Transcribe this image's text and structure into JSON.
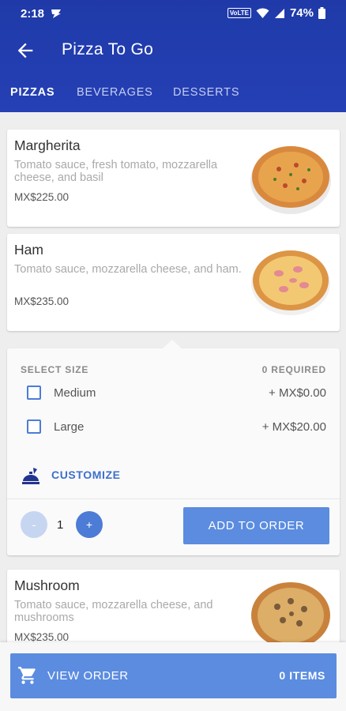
{
  "status_bar": {
    "time": "2:18",
    "network": "VoLTE",
    "battery": "74%"
  },
  "header": {
    "title": "Pizza To Go"
  },
  "tabs": [
    {
      "label": "PIZZAS",
      "active": true
    },
    {
      "label": "BEVERAGES",
      "active": false
    },
    {
      "label": "DESSERTS",
      "active": false
    }
  ],
  "items": [
    {
      "name": "Margherita",
      "description": "Tomato sauce, fresh tomato, mozzarella cheese, and basil",
      "price": "MX$225.00",
      "image": "margherita-pizza"
    },
    {
      "name": "Ham",
      "description": "Tomato sauce, mozzarella cheese, and ham.",
      "price": "MX$235.00",
      "image": "ham-pizza"
    },
    {
      "name": "Mushroom",
      "description": "Tomato sauce, mozzarella cheese, and mushrooms",
      "price": "MX$235.00",
      "image": "mushroom-pizza"
    }
  ],
  "options": {
    "header": "SELECT SIZE",
    "required": "0 REQUIRED",
    "sizes": [
      {
        "label": "Medium",
        "price": "+ MX$0.00",
        "checked": false
      },
      {
        "label": "Large",
        "price": "+ MX$20.00",
        "checked": false
      }
    ],
    "customize_label": "CUSTOMIZE",
    "quantity": "1",
    "minus": "-",
    "plus": "+",
    "add_button": "ADD TO ORDER"
  },
  "bottom": {
    "view_order": "VIEW ORDER",
    "items_count": "0 ITEMS"
  },
  "colors": {
    "header": "#2540b5",
    "accent": "#5b8ce0",
    "link": "#3e6fcc"
  }
}
